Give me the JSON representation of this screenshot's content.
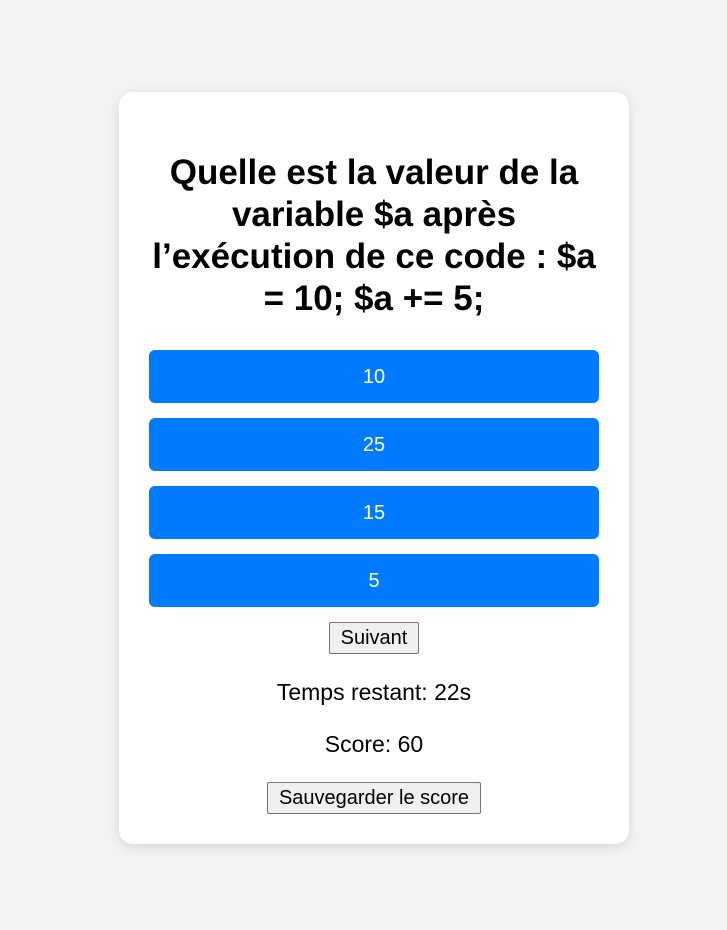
{
  "quiz": {
    "question": "Quelle est la valeur de la variable $a après l’exécution de ce code : $a = 10; $a += 5;",
    "answers": [
      "10",
      "25",
      "15",
      "5"
    ],
    "next_label": "Suivant",
    "timer_text": "Temps restant: 22s",
    "score_text": "Score: 60",
    "save_label": "Sauvegarder le score"
  },
  "colors": {
    "page_background": "#f3f3f3",
    "card_background": "#ffffff",
    "answer_button": "#007bff",
    "answer_text": "#ffffff"
  }
}
